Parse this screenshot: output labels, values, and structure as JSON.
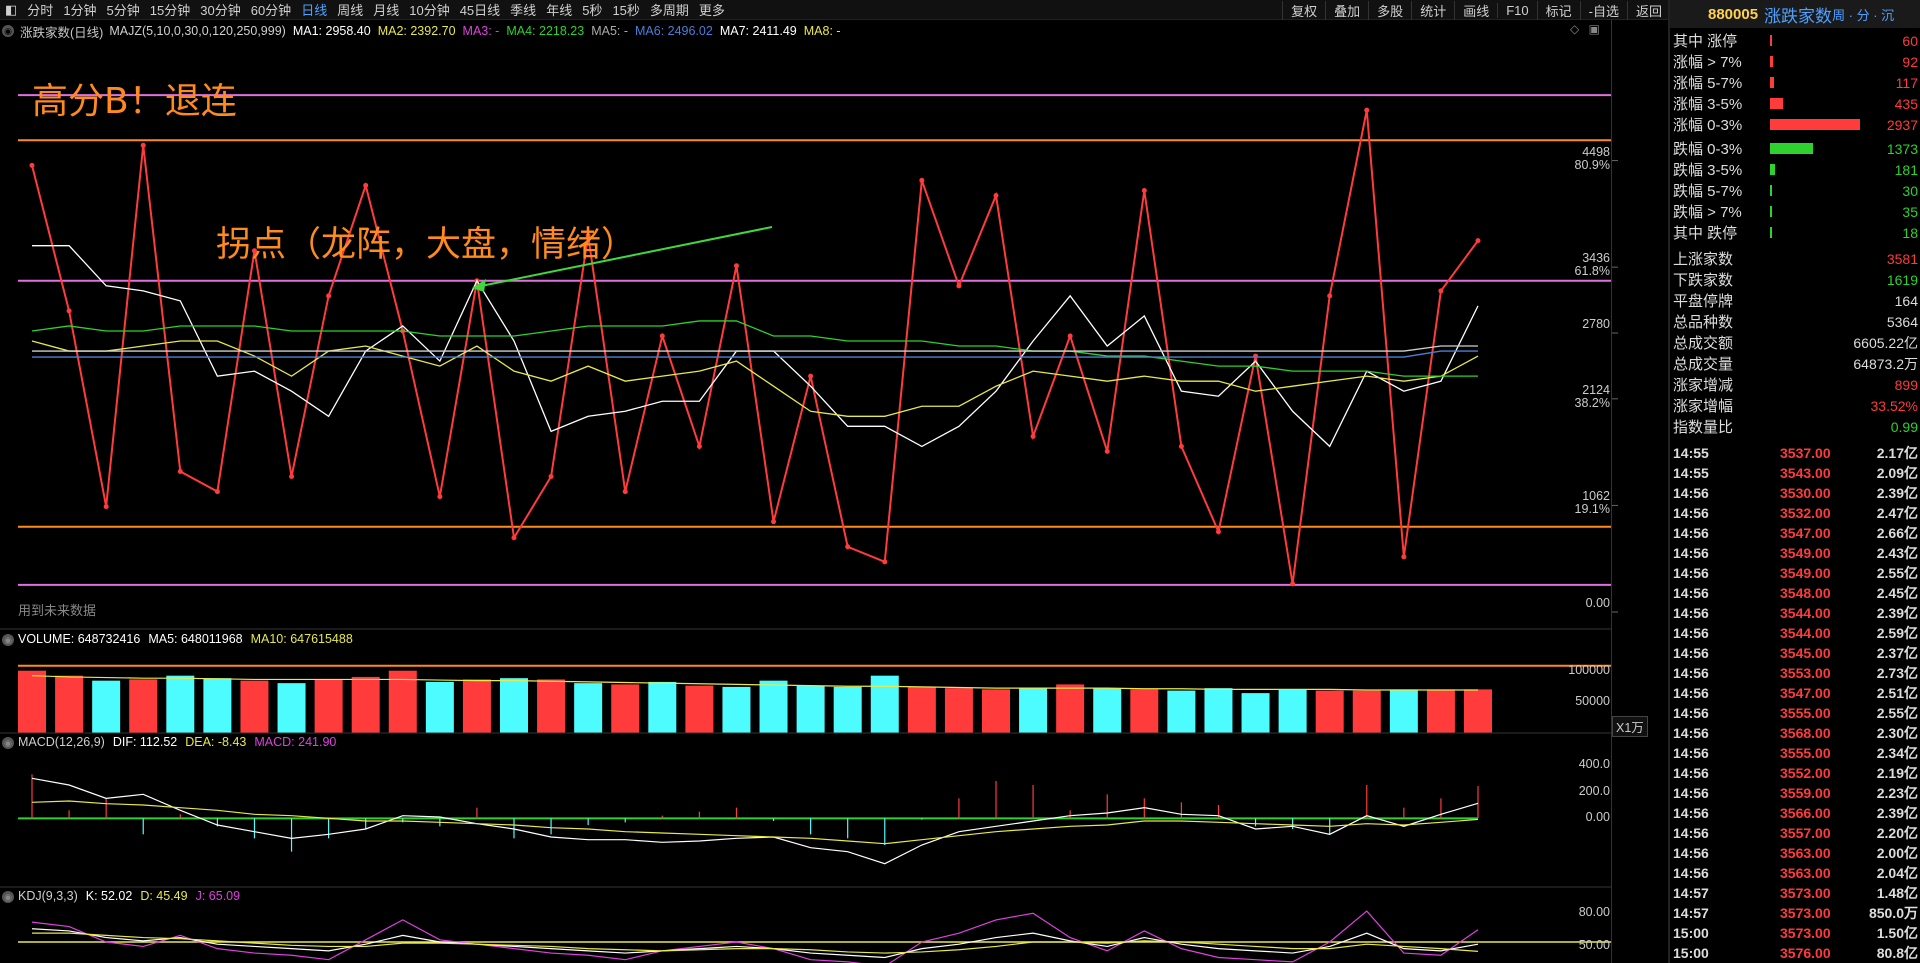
{
  "toolbar": {
    "periods": [
      "分时",
      "1分钟",
      "5分钟",
      "15分钟",
      "30分钟",
      "60分钟",
      "日线",
      "周线",
      "月线",
      "10分钟",
      "45日线",
      "季线",
      "年线",
      "5秒",
      "15秒",
      "多周期",
      "更多"
    ],
    "active": "日线",
    "right": [
      "复权",
      "叠加",
      "多股",
      "统计",
      "画线",
      "F10",
      "标记",
      "-自选",
      "返回"
    ]
  },
  "main_legend": {
    "title": "涨跌家数(日线)",
    "items": [
      {
        "text": "MAJZ(5,10,0,30,0,120,250,999)",
        "color": "#cfcfcf"
      },
      {
        "text": "MA1: 2958.40",
        "color": "#ffffff"
      },
      {
        "text": "MA2: 2392.70",
        "color": "#e8e84a"
      },
      {
        "text": "MA3: -",
        "color": "#e040e0"
      },
      {
        "text": "MA4: 2218.23",
        "color": "#2ed12e"
      },
      {
        "text": "MA5: -",
        "color": "#aaaaaa"
      },
      {
        "text": "MA6: 2496.02",
        "color": "#4a7fd8"
      },
      {
        "text": "MA7: 2411.49",
        "color": "#ffffff"
      },
      {
        "text": "MA8: -",
        "color": "#e8e84a"
      }
    ]
  },
  "annotations": {
    "big_title": "高分B！退连",
    "turning_point": "拐点（龙阵，大盘，情绪）",
    "future_data": "用到未来数据"
  },
  "chart_data": [
    {
      "type": "line",
      "name": "涨跌家数",
      "ylim": [
        0,
        5500
      ],
      "yticks": [
        {
          "value": 4498,
          "label": "4498",
          "pct": "80.9%"
        },
        {
          "value": 3436,
          "label": "3436",
          "pct": "61.8%"
        },
        {
          "value": 2780,
          "label": "2780",
          "pct": ""
        },
        {
          "value": 2124,
          "label": "2124",
          "pct": "38.2%"
        },
        {
          "value": 1062,
          "label": "1062",
          "pct": "19.1%"
        },
        {
          "value": 0,
          "label": "0.00",
          "pct": ""
        }
      ],
      "hlines": [
        {
          "value": 5150,
          "color": "#e070e0"
        },
        {
          "value": 4700,
          "color": "#ff8a1e"
        },
        {
          "value": 3300,
          "color": "#e070e0"
        },
        {
          "value": 850,
          "color": "#ff8a1e"
        },
        {
          "value": 270,
          "color": "#e070e0"
        }
      ],
      "series": [
        {
          "color": "#ff3b3b",
          "values": [
            4450,
            3000,
            1050,
            4650,
            1400,
            1200,
            3600,
            1350,
            3150,
            4250,
            2800,
            1150,
            3300,
            740,
            1350,
            3750,
            1200,
            2750,
            1650,
            3450,
            900,
            2350,
            650,
            500,
            4300,
            3250,
            4150,
            1750,
            2750,
            1600,
            4200,
            1650,
            800,
            2550,
            280,
            3150,
            5000,
            550,
            3200,
            3700
          ]
        },
        {
          "color": "#ffffff",
          "values": [
            3650,
            3650,
            3250,
            3200,
            3100,
            2350,
            2400,
            2200,
            1950,
            2600,
            2850,
            2500,
            3300,
            2700,
            1800,
            1950,
            2000,
            2100,
            2100,
            2600,
            2600,
            2250,
            1850,
            1850,
            1650,
            1850,
            2200,
            2700,
            3150,
            2650,
            2950,
            2200,
            2150,
            2500,
            2000,
            1650,
            2400,
            2200,
            2300,
            3050
          ]
        },
        {
          "color": "#e8e84a",
          "values": [
            2700,
            2600,
            2600,
            2650,
            2700,
            2700,
            2550,
            2350,
            2600,
            2650,
            2550,
            2450,
            2650,
            2400,
            2300,
            2450,
            2300,
            2350,
            2400,
            2500,
            2250,
            2000,
            1950,
            1950,
            2050,
            2050,
            2250,
            2400,
            2350,
            2300,
            2350,
            2300,
            2300,
            2200,
            2250,
            2300,
            2350,
            2300,
            2350,
            2550
          ]
        },
        {
          "color": "#2ed12e",
          "values": [
            2800,
            2850,
            2800,
            2800,
            2850,
            2850,
            2850,
            2800,
            2800,
            2800,
            2800,
            2750,
            2750,
            2750,
            2800,
            2850,
            2850,
            2850,
            2900,
            2900,
            2750,
            2750,
            2700,
            2700,
            2700,
            2650,
            2650,
            2600,
            2600,
            2550,
            2550,
            2500,
            2450,
            2450,
            2400,
            2400,
            2400,
            2350,
            2350,
            2350
          ]
        },
        {
          "color": "#4a7fd8",
          "values": [
            2540,
            2540,
            2540,
            2540,
            2540,
            2540,
            2540,
            2540,
            2540,
            2540,
            2540,
            2540,
            2540,
            2540,
            2540,
            2540,
            2540,
            2540,
            2540,
            2540,
            2540,
            2540,
            2540,
            2540,
            2540,
            2540,
            2540,
            2540,
            2540,
            2540,
            2540,
            2540,
            2540,
            2540,
            2540,
            2540,
            2540,
            2540,
            2600,
            2600
          ]
        },
        {
          "color": "#cfcfcf",
          "values": [
            2600,
            2600,
            2600,
            2600,
            2600,
            2600,
            2600,
            2600,
            2600,
            2600,
            2600,
            2600,
            2600,
            2600,
            2600,
            2600,
            2600,
            2600,
            2600,
            2600,
            2600,
            2600,
            2600,
            2600,
            2600,
            2600,
            2600,
            2600,
            2600,
            2600,
            2600,
            2600,
            2600,
            2600,
            2600,
            2600,
            2600,
            2600,
            2650,
            2650
          ]
        }
      ]
    },
    {
      "type": "bar",
      "name": "VOLUME",
      "legend": [
        {
          "text": "VOLUME: 648732416",
          "color": "#ffffff"
        },
        {
          "text": "MA5: 648011968",
          "color": "#ffffff"
        },
        {
          "text": "MA10: 647615488",
          "color": "#e8e84a"
        }
      ],
      "ylim": [
        0,
        130000
      ],
      "yticks": [
        {
          "value": 100000,
          "label": "100000"
        },
        {
          "value": 50000,
          "label": "50000"
        }
      ],
      "unit": "X1万",
      "values": [
        100000,
        92000,
        84000,
        86000,
        92000,
        88000,
        84000,
        80000,
        86000,
        90000,
        100000,
        82000,
        86000,
        88000,
        86000,
        80000,
        78000,
        82000,
        76000,
        74000,
        84000,
        76000,
        74000,
        92000,
        74000,
        72000,
        70000,
        72000,
        78000,
        72000,
        70000,
        68000,
        72000,
        64000,
        70000,
        68000,
        68000,
        70000,
        70000,
        70000
      ],
      "up": [
        true,
        true,
        false,
        true,
        false,
        false,
        true,
        false,
        true,
        true,
        true,
        false,
        true,
        false,
        true,
        false,
        true,
        false,
        true,
        false,
        false,
        false,
        false,
        false,
        true,
        true,
        true,
        false,
        true,
        false,
        true,
        false,
        false,
        false,
        false,
        true,
        true,
        false,
        true,
        true
      ],
      "ma": [
        92000,
        90000,
        89000,
        88000,
        88000,
        87000,
        86000,
        86000,
        86000,
        86000,
        86000,
        85000,
        84000,
        84000,
        83000,
        82000,
        81000,
        80000,
        79000,
        78000,
        77000,
        76000,
        75000,
        75000,
        74000,
        73000,
        72000,
        72000,
        72000,
        72000,
        71000,
        71000,
        70000,
        70000,
        70000,
        70000,
        69000,
        69000,
        69000,
        69000
      ]
    },
    {
      "type": "bar",
      "name": "MACD",
      "legend": [
        {
          "text": "MACD(12,26,9)",
          "color": "#cfcfcf"
        },
        {
          "text": "DIF: 112.52",
          "color": "#ffffff"
        },
        {
          "text": "DEA: -8.43",
          "color": "#e8e84a"
        },
        {
          "text": "MACD: 241.90",
          "color": "#e040e0"
        }
      ],
      "ylim": [
        -500,
        550
      ],
      "yticks": [
        {
          "value": 400,
          "label": "400.0"
        },
        {
          "value": 200,
          "label": "200.0"
        },
        {
          "value": 0,
          "label": "0.00"
        }
      ],
      "values": [
        330,
        60,
        150,
        -120,
        30,
        -60,
        -150,
        -250,
        -150,
        -80,
        -30,
        -60,
        80,
        -150,
        -120,
        -50,
        -30,
        20,
        50,
        80,
        -20,
        -120,
        -150,
        -200,
        -10,
        150,
        280,
        250,
        60,
        180,
        150,
        120,
        100,
        -60,
        -80,
        -120,
        250,
        80,
        150,
        241.9
      ],
      "dif": [
        300,
        250,
        150,
        180,
        60,
        -50,
        -100,
        -150,
        -120,
        -80,
        20,
        10,
        -40,
        -80,
        -140,
        -160,
        -160,
        -180,
        -170,
        -150,
        -140,
        -220,
        -250,
        -340,
        -200,
        -100,
        -60,
        -20,
        20,
        40,
        80,
        30,
        20,
        -80,
        -60,
        -120,
        20,
        -60,
        30,
        112.52
      ],
      "dea": [
        120,
        130,
        110,
        100,
        80,
        60,
        30,
        20,
        0,
        -20,
        -20,
        -30,
        -40,
        -50,
        -70,
        -80,
        -100,
        -110,
        -120,
        -130,
        -140,
        -150,
        -170,
        -190,
        -160,
        -130,
        -100,
        -80,
        -60,
        -50,
        -20,
        -20,
        -30,
        -40,
        -50,
        -60,
        -40,
        -50,
        -30,
        -8.43
      ]
    },
    {
      "type": "line",
      "name": "KDJ",
      "legend": [
        {
          "text": "KDJ(9,3,3)",
          "color": "#cfcfcf"
        },
        {
          "text": "K: 52.02",
          "color": "#ffffff"
        },
        {
          "text": "D: 45.49",
          "color": "#e8e84a"
        },
        {
          "text": "J: 65.09",
          "color": "#e040e0"
        }
      ],
      "ylim": [
        35,
        92
      ],
      "yticks": [
        {
          "value": 80,
          "label": "80.00"
        },
        {
          "value": 50,
          "label": "50.00"
        }
      ],
      "hline": 54,
      "k": [
        66,
        64,
        58,
        55,
        58,
        52,
        50,
        48,
        46,
        52,
        60,
        54,
        52,
        50,
        48,
        46,
        44,
        46,
        48,
        50,
        48,
        44,
        42,
        40,
        48,
        52,
        58,
        62,
        55,
        50,
        58,
        52,
        48,
        46,
        44,
        50,
        62,
        48,
        46,
        52.02
      ],
      "d": [
        62,
        62,
        60,
        58,
        57,
        55,
        53,
        51,
        50,
        50,
        53,
        53,
        52,
        51,
        50,
        48,
        47,
        46,
        47,
        48,
        48,
        47,
        45,
        44,
        45,
        47,
        50,
        54,
        54,
        53,
        55,
        54,
        52,
        50,
        48,
        48,
        52,
        50,
        48,
        45.49
      ],
      "j": [
        72,
        68,
        54,
        50,
        60,
        48,
        44,
        42,
        38,
        56,
        74,
        56,
        52,
        48,
        44,
        42,
        38,
        46,
        50,
        54,
        48,
        38,
        36,
        32,
        54,
        62,
        74,
        80,
        58,
        46,
        64,
        48,
        40,
        38,
        36,
        54,
        82,
        44,
        42,
        65.09
      ]
    }
  ],
  "side": {
    "code": "880005",
    "name": "涨跌家数",
    "tabs": "周 · 分 · 沉",
    "stats": [
      {
        "label": "其中 涨停",
        "value": "60",
        "bar": 0.01,
        "color": "#ff3b3b"
      },
      {
        "label": "涨幅 > 7%",
        "value": "92",
        "bar": 0.03,
        "color": "#ff3b3b"
      },
      {
        "label": "涨幅 5-7%",
        "value": "117",
        "bar": 0.04,
        "color": "#ff3b3b"
      },
      {
        "label": "涨幅 3-5%",
        "value": "435",
        "bar": 0.14,
        "color": "#ff3b3b"
      },
      {
        "label": "涨幅 0-3%",
        "value": "2937",
        "bar": 0.95,
        "color": "#ff3b3b"
      },
      {
        "label": "跌幅 0-3%",
        "value": "1373",
        "bar": 0.45,
        "color": "#2ed12e"
      },
      {
        "label": "跌幅 3-5%",
        "value": "181",
        "bar": 0.05,
        "color": "#2ed12e"
      },
      {
        "label": "跌幅 5-7%",
        "value": "30",
        "bar": 0.01,
        "color": "#2ed12e"
      },
      {
        "label": "跌幅 > 7%",
        "value": "35",
        "bar": 0.01,
        "color": "#2ed12e"
      },
      {
        "label": "其中 跌停",
        "value": "18",
        "bar": 0.01,
        "color": "#2ed12e"
      }
    ],
    "summary": [
      {
        "label": "上涨家数",
        "value": "3581",
        "color": "#ff3b3b"
      },
      {
        "label": "下跌家数",
        "value": "1619",
        "color": "#2ed12e"
      },
      {
        "label": "平盘停牌",
        "value": "164",
        "color": "#dddddd"
      },
      {
        "label": "总品种数",
        "value": "5364",
        "color": "#dddddd"
      },
      {
        "label": "总成交额",
        "value": "6605.22亿",
        "color": "#dddddd"
      },
      {
        "label": "总成交量",
        "value": "64873.2万",
        "color": "#dddddd"
      },
      {
        "label": "涨家增减",
        "value": "899",
        "color": "#ff3b3b"
      },
      {
        "label": "涨家增幅",
        "value": "33.52%",
        "color": "#ff3b3b"
      },
      {
        "label": "指数量比",
        "value": "0.99",
        "color": "#2ed12e"
      }
    ],
    "ticks": [
      {
        "t": "14:55",
        "p": "3537.00",
        "a": "2.17亿"
      },
      {
        "t": "14:55",
        "p": "3543.00",
        "a": "2.09亿"
      },
      {
        "t": "14:56",
        "p": "3530.00",
        "a": "2.39亿"
      },
      {
        "t": "14:56",
        "p": "3532.00",
        "a": "2.47亿"
      },
      {
        "t": "14:56",
        "p": "3547.00",
        "a": "2.66亿"
      },
      {
        "t": "14:56",
        "p": "3549.00",
        "a": "2.43亿"
      },
      {
        "t": "14:56",
        "p": "3549.00",
        "a": "2.55亿"
      },
      {
        "t": "14:56",
        "p": "3548.00",
        "a": "2.45亿"
      },
      {
        "t": "14:56",
        "p": "3544.00",
        "a": "2.39亿"
      },
      {
        "t": "14:56",
        "p": "3544.00",
        "a": "2.59亿"
      },
      {
        "t": "14:56",
        "p": "3545.00",
        "a": "2.37亿"
      },
      {
        "t": "14:56",
        "p": "3553.00",
        "a": "2.73亿"
      },
      {
        "t": "14:56",
        "p": "3547.00",
        "a": "2.51亿"
      },
      {
        "t": "14:56",
        "p": "3555.00",
        "a": "2.55亿"
      },
      {
        "t": "14:56",
        "p": "3568.00",
        "a": "2.30亿"
      },
      {
        "t": "14:56",
        "p": "3555.00",
        "a": "2.34亿"
      },
      {
        "t": "14:56",
        "p": "3552.00",
        "a": "2.19亿"
      },
      {
        "t": "14:56",
        "p": "3559.00",
        "a": "2.23亿"
      },
      {
        "t": "14:56",
        "p": "3566.00",
        "a": "2.39亿"
      },
      {
        "t": "14:56",
        "p": "3557.00",
        "a": "2.20亿"
      },
      {
        "t": "14:56",
        "p": "3563.00",
        "a": "2.00亿"
      },
      {
        "t": "14:56",
        "p": "3563.00",
        "a": "2.04亿"
      },
      {
        "t": "14:57",
        "p": "3573.00",
        "a": "1.48亿"
      },
      {
        "t": "14:57",
        "p": "3573.00",
        "a": "850.0万"
      },
      {
        "t": "15:00",
        "p": "3573.00",
        "a": "1.50亿"
      },
      {
        "t": "15:00",
        "p": "3576.00",
        "a": "80.8亿"
      }
    ]
  }
}
